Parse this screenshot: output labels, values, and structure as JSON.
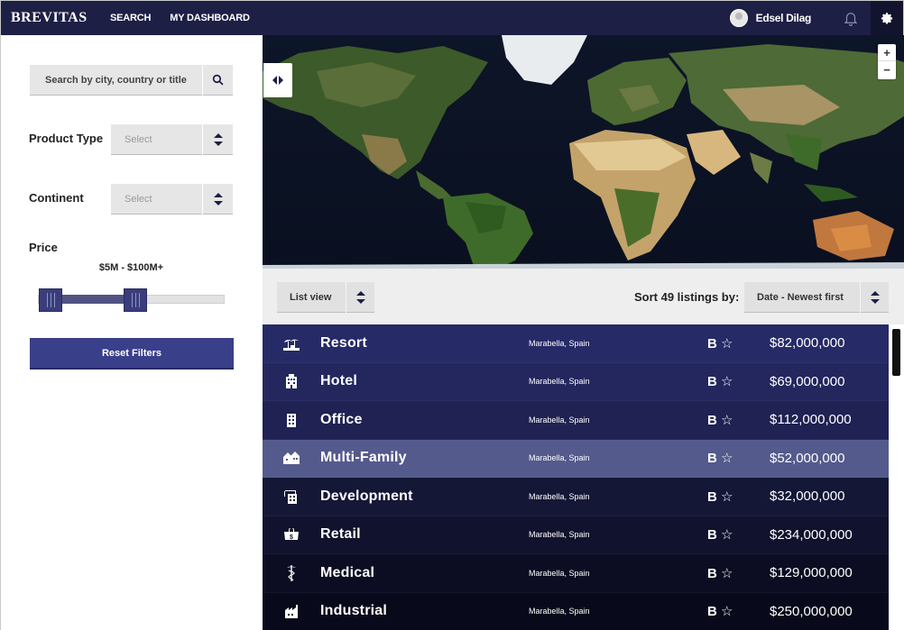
{
  "header": {
    "logo": "BREVITAS",
    "nav": [
      "SEARCH",
      "MY DASHBOARD"
    ],
    "user_name": "Edsel Dilag",
    "icons": [
      "bell-icon",
      "gear-icon"
    ]
  },
  "sidebar": {
    "search_placeholder": "Search by city, country or title",
    "product_type_label": "Product Type",
    "product_type_value": "Select",
    "continent_label": "Continent",
    "continent_value": "Select",
    "price_label": "Price",
    "price_range": "$5M - $100M+",
    "price_slider": {
      "min_pos": 0.0,
      "max_pos": 0.52
    },
    "reset_label": "Reset Filters"
  },
  "map": {
    "zoom_in": "+",
    "zoom_out": "−"
  },
  "toolbar": {
    "view_value": "List view",
    "sort_label": "Sort 49 listings by:",
    "sort_value": "Date - Newest first"
  },
  "listings": [
    {
      "icon": "resort-icon",
      "title": "Resort",
      "location": "Marabella, Spain",
      "rating": "B",
      "price": "$82,000,000",
      "bg": "#262a66"
    },
    {
      "icon": "hotel-icon",
      "title": "Hotel",
      "location": "Marabella, Spain",
      "rating": "B",
      "price": "$69,000,000",
      "bg": "#24275e"
    },
    {
      "icon": "office-icon",
      "title": "Office",
      "location": "Marabella, Spain",
      "rating": "B",
      "price": "$112,000,000",
      "bg": "#1f2252"
    },
    {
      "icon": "multi-family-icon",
      "title": "Multi-Family",
      "location": "Marabella, Spain",
      "rating": "B",
      "price": "$52,000,000",
      "bg": "#545a8c"
    },
    {
      "icon": "development-icon",
      "title": "Development",
      "location": "Marabella, Spain",
      "rating": "B",
      "price": "$32,000,000",
      "bg": "#151737"
    },
    {
      "icon": "retail-icon",
      "title": "Retail",
      "location": "Marabella, Spain",
      "rating": "B",
      "price": "$234,000,000",
      "bg": "#11122d"
    },
    {
      "icon": "medical-icon",
      "title": "Medical",
      "location": "Marabella, Spain",
      "rating": "B",
      "price": "$129,000,000",
      "bg": "#0c0d22"
    },
    {
      "icon": "industrial-icon",
      "title": "Industrial",
      "location": "Marabella, Spain",
      "rating": "B",
      "price": "$250,000,000",
      "bg": "#08091a"
    }
  ]
}
